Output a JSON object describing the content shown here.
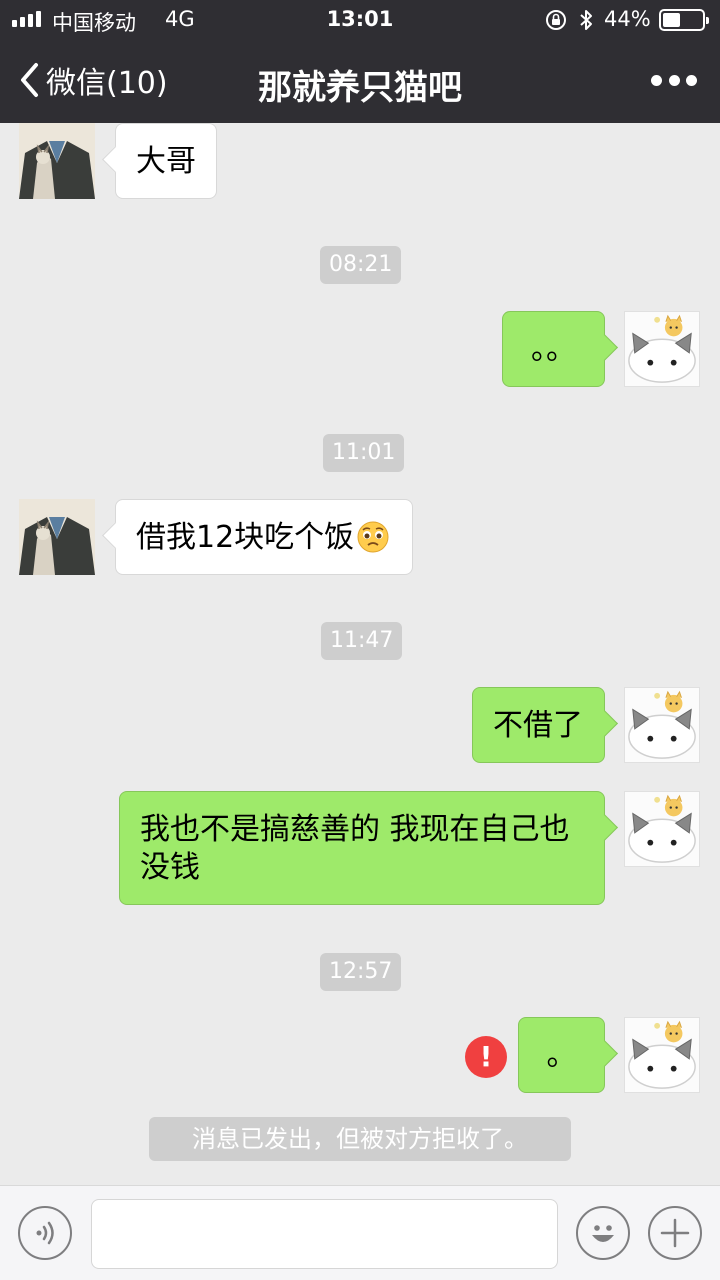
{
  "status_bar": {
    "carrier": "中国移动",
    "network": "4G",
    "time": "13:01",
    "battery_percent_text": "44%",
    "battery_level": 0.44,
    "signal_bars": 4
  },
  "nav": {
    "back_label": "微信(10)",
    "title": "那就养只猫吧"
  },
  "messages": [
    {
      "from": "friend",
      "text": "大哥"
    },
    {
      "type": "time",
      "text": "08:21"
    },
    {
      "from": "me",
      "text": "。。"
    },
    {
      "type": "time",
      "text": "11:01"
    },
    {
      "from": "friend",
      "text": "借我12块吃个饭",
      "emoji": "pleading-face"
    },
    {
      "type": "time",
      "text": "11:47"
    },
    {
      "from": "me",
      "text": "不借了"
    },
    {
      "from": "me",
      "text": "我也不是搞慈善的 我现在自己也没钱"
    },
    {
      "type": "time",
      "text": "12:57"
    },
    {
      "from": "me",
      "text": "。",
      "failed": true,
      "error_mark": "!"
    },
    {
      "type": "system",
      "text": "消息已发出，但被对方拒收了。"
    }
  ],
  "input_bar": {
    "input_value": "",
    "icons": [
      "voice-icon",
      "emoji-icon",
      "plus-icon"
    ]
  },
  "colors": {
    "nav_bg": "#2f2e33",
    "chat_bg": "#ebebeb",
    "bubble_out": "#9eea6a",
    "bubble_in": "#ffffff",
    "error": "#f04040"
  }
}
